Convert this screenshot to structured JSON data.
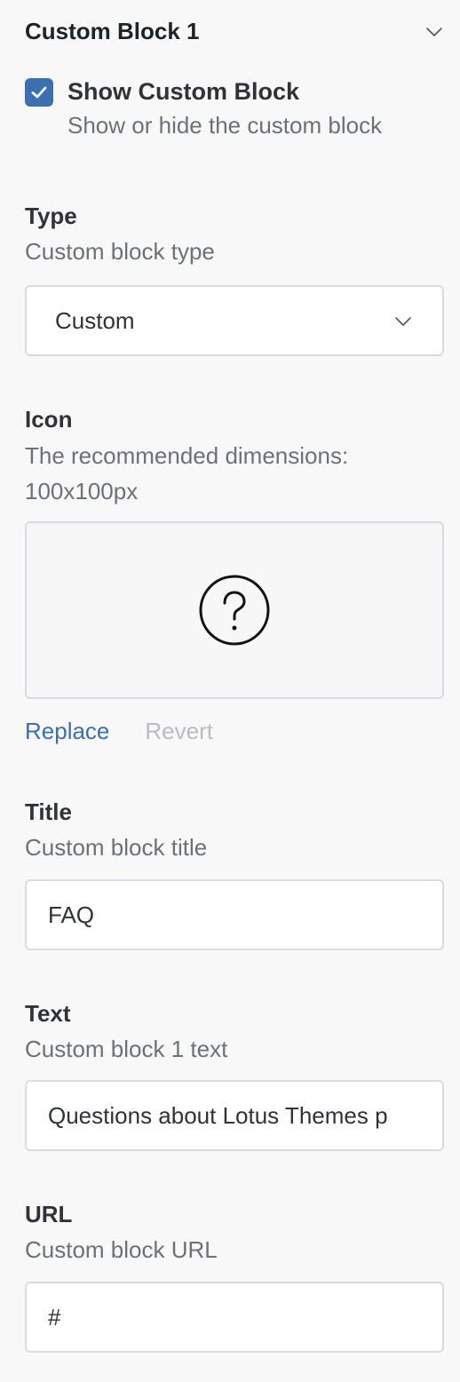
{
  "section": {
    "title": "Custom Block 1"
  },
  "show_block": {
    "label": "Show Custom Block",
    "description": "Show or hide the custom block",
    "checked": true
  },
  "type_field": {
    "label": "Type",
    "description": "Custom block type",
    "value": "Custom"
  },
  "icon_field": {
    "label": "Icon",
    "description_line1": "The recommended dimensions:",
    "description_line2": "100x100px",
    "preview_icon": "question-circle-icon",
    "replace_label": "Replace",
    "revert_label": "Revert"
  },
  "title_field": {
    "label": "Title",
    "description": "Custom block title",
    "value": "FAQ"
  },
  "text_field": {
    "label": "Text",
    "description": "Custom block 1 text",
    "value": "Questions about Lotus Themes p"
  },
  "url_field": {
    "label": "URL",
    "description": "Custom block URL",
    "value": "#"
  },
  "colors": {
    "accent": "#3a6fb0",
    "muted_text": "#6c7178",
    "disabled_text": "#b9bdc2",
    "border": "#d9dbde",
    "background": "#f8f8f8"
  }
}
